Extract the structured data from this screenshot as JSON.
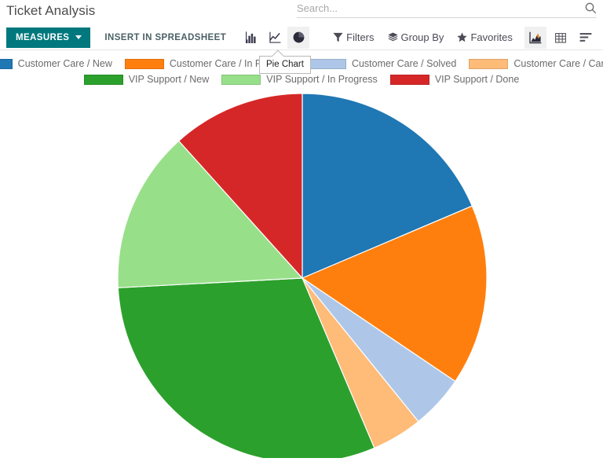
{
  "breadcrumb": "Ticket Analysis",
  "search": {
    "placeholder": "Search...",
    "value": ""
  },
  "toolbar": {
    "measures_label": "MEASURES",
    "insert_spreadsheet_label": "INSERT IN SPREADSHEET",
    "chart_type_buttons": [
      {
        "name": "bar-chart-icon",
        "title": "Bar Chart",
        "active": false
      },
      {
        "name": "line-chart-icon",
        "title": "Line Chart",
        "active": false
      },
      {
        "name": "pie-chart-icon",
        "title": "Pie Chart",
        "active": true
      }
    ],
    "filters_label": "Filters",
    "group_by_label": "Group By",
    "favorites_label": "Favorites",
    "view_buttons": [
      {
        "name": "graph-view-icon",
        "title": "Graph",
        "active": true
      },
      {
        "name": "pivot-view-icon",
        "title": "Pivot",
        "active": false
      },
      {
        "name": "list-view-icon",
        "title": "List",
        "active": false
      }
    ],
    "accent_color": "#00787d"
  },
  "tooltip": {
    "text": "Pie Chart"
  },
  "chart_data": {
    "type": "pie",
    "title": "Ticket Analysis",
    "legend_position": "top",
    "categories": [
      "Customer Care / New",
      "Customer Care / In Progress",
      "Customer Care / Solved",
      "Customer Care / Canceled",
      "VIP Support / New",
      "VIP Support / In Progress",
      "VIP Support / Done"
    ],
    "values": [
      18.6,
      15.8,
      4.7,
      4.4,
      30.6,
      14.2,
      11.7
    ],
    "colors": [
      "#1f77b4",
      "#ff7f0e",
      "#aec7e8",
      "#ffbb78",
      "#2ca02c",
      "#98df8a",
      "#d62728"
    ],
    "start_angle_deg": 0,
    "direction": "clockwise",
    "slices": [
      {
        "label": "Customer Care / New",
        "color": "#1f77b4",
        "percent": 18.6,
        "start_deg": 0,
        "end_deg": 67
      },
      {
        "label": "Customer Care / In Progress",
        "color": "#ff7f0e",
        "percent": 15.8,
        "start_deg": 67,
        "end_deg": 124
      },
      {
        "label": "Customer Care / Solved",
        "color": "#aec7e8",
        "percent": 4.7,
        "start_deg": 124,
        "end_deg": 141
      },
      {
        "label": "Customer Care / Canceled",
        "color": "#ffbb78",
        "percent": 4.4,
        "start_deg": 141,
        "end_deg": 157
      },
      {
        "label": "VIP Support / New",
        "color": "#2ca02c",
        "percent": 30.6,
        "start_deg": 157,
        "end_deg": 267
      },
      {
        "label": "VIP Support / In Progress",
        "color": "#98df8a",
        "percent": 14.2,
        "start_deg": 267,
        "end_deg": 318
      },
      {
        "label": "VIP Support / Done",
        "color": "#d62728",
        "percent": 11.7,
        "start_deg": 318,
        "end_deg": 360
      }
    ]
  }
}
